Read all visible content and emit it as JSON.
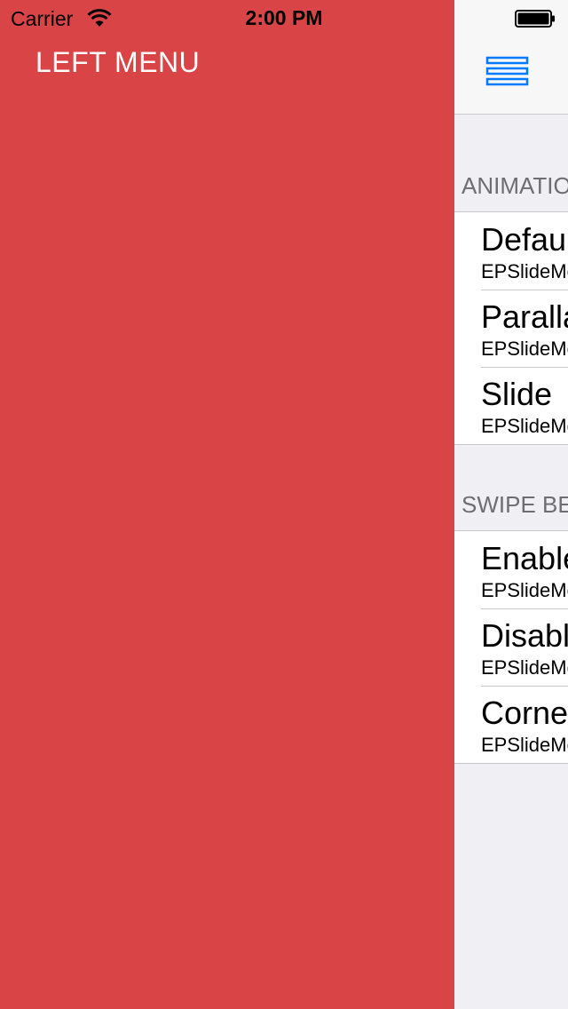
{
  "status_bar": {
    "carrier": "Carrier",
    "time": "2:00 PM"
  },
  "left_menu": {
    "title": "LEFT MENU",
    "background_color": "#D94446"
  },
  "nav_bar": {
    "menu_icon": "hamburger-menu-icon",
    "tint_color": "#007AFF"
  },
  "sections": [
    {
      "header": "ANIMATIONS",
      "rows": [
        {
          "title": "Default",
          "subtitle": "EPSlideMenuAnimationDefault"
        },
        {
          "title": "Parallax",
          "subtitle": "EPSlideMenuAnimationParallax"
        },
        {
          "title": "Slide",
          "subtitle": "EPSlideMenuAnimationSlide"
        }
      ]
    },
    {
      "header": "SWIPE BEHAVIOR",
      "rows": [
        {
          "title": "Enabled",
          "subtitle": "EPSlideMenuSwipeEnabled"
        },
        {
          "title": "Disabled",
          "subtitle": "EPSlideMenuSwipeDisabled"
        },
        {
          "title": "Corner",
          "subtitle": "EPSlideMenuSwipeCorner"
        }
      ]
    }
  ]
}
